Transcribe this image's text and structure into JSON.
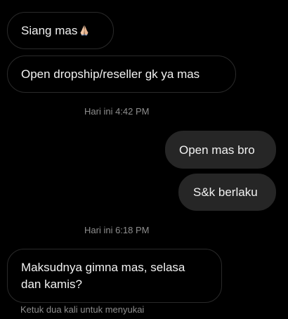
{
  "colors": {
    "background": "#000000",
    "incoming_border": "#2a2a2a",
    "outgoing_fill": "#262626",
    "text": "#f2f2f2",
    "meta_text": "#8e8e8e"
  },
  "messages": [
    {
      "direction": "incoming",
      "text": "Siang mas",
      "emoji": "folded-hands-icon"
    },
    {
      "direction": "incoming",
      "text": "Open dropship/reseller gk ya mas"
    },
    {
      "direction": "outgoing",
      "text": "Open mas bro"
    },
    {
      "direction": "outgoing",
      "text": "S&k berlaku"
    },
    {
      "direction": "incoming",
      "text_line1": "Maksudnya gimna mas, selasa",
      "text_line2": "dan kamis?"
    }
  ],
  "timestamps": [
    "Hari ini 4:42 PM",
    "Hari ini 6:18 PM"
  ],
  "hint": "Ketuk dua kali untuk menyukai"
}
